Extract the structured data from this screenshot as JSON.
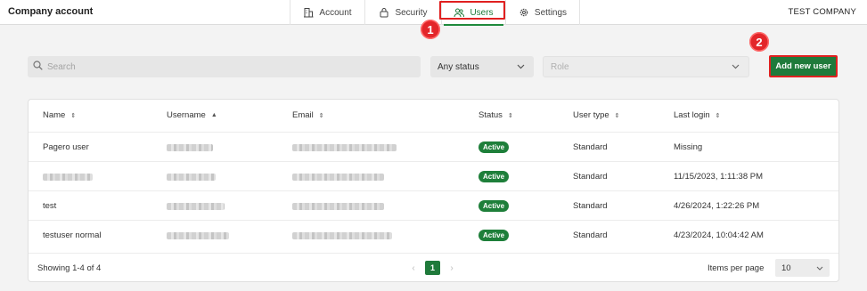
{
  "header": {
    "title": "Company account",
    "company": "TEST COMPANY",
    "tabs": [
      {
        "label": "Account",
        "icon": "building-icon"
      },
      {
        "label": "Security",
        "icon": "lock-icon"
      },
      {
        "label": "Users",
        "icon": "users-icon",
        "active": true
      },
      {
        "label": "Settings",
        "icon": "gear-icon"
      }
    ]
  },
  "callouts": {
    "one": "1",
    "two": "2"
  },
  "filters": {
    "search_placeholder": "Search",
    "status_value": "Any status",
    "role_placeholder": "Role"
  },
  "add_user_label": "Add new user",
  "table": {
    "columns": [
      "Name",
      "Username",
      "Email",
      "Status",
      "User type",
      "Last login"
    ],
    "rows": [
      {
        "name": "Pagero user",
        "status": "Active",
        "user_type": "Standard",
        "last_login": "Missing"
      },
      {
        "name": "",
        "status": "Active",
        "user_type": "Standard",
        "last_login": "11/15/2023, 1:11:38 PM"
      },
      {
        "name": "test",
        "status": "Active",
        "user_type": "Standard",
        "last_login": "4/26/2024, 1:22:26 PM"
      },
      {
        "name": "testuser normal",
        "status": "Active",
        "user_type": "Standard",
        "last_login": "4/23/2024, 10:04:42 AM"
      }
    ]
  },
  "footer": {
    "showing": "Showing 1-4 of 4",
    "page": "1",
    "items_per_page_label": "Items per page",
    "items_per_page_value": "10"
  },
  "colors": {
    "accent": "#1f7a3b",
    "highlight": "#e02020"
  }
}
